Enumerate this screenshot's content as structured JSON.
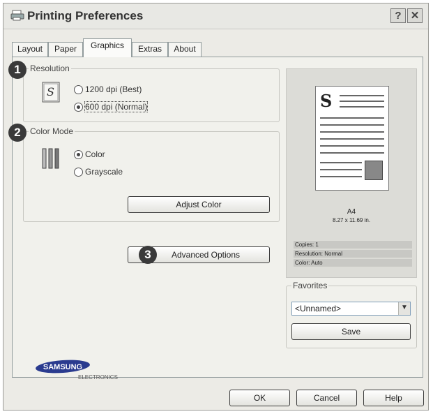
{
  "window": {
    "title": "Printing Preferences",
    "help_button": "?",
    "close_button": "✕"
  },
  "tabs": [
    {
      "label": "Layout"
    },
    {
      "label": "Paper"
    },
    {
      "label": "Graphics"
    },
    {
      "label": "Extras"
    },
    {
      "label": "About"
    }
  ],
  "active_tab": "Graphics",
  "resolution": {
    "badge": "1",
    "label": "Resolution",
    "icon_letter": "S",
    "options": [
      "1200 dpi (Best)",
      "600 dpi (Normal)"
    ],
    "selected": "600 dpi (Normal)"
  },
  "color_mode": {
    "badge": "2",
    "label": "Color Mode",
    "icon_glyph": "jjj",
    "options": [
      "Color",
      "Grayscale"
    ],
    "selected": "Color",
    "adjust_button": "Adjust Color"
  },
  "advanced": {
    "badge": "3",
    "button": "Advanced Options"
  },
  "preview": {
    "page_letter": "S",
    "paper_name": "A4",
    "paper_size": "8.27 x 11.69 in.",
    "info": [
      "Copies: 1",
      "Resolution: Normal",
      "Color: Auto"
    ]
  },
  "favorites": {
    "label": "Favorites",
    "selected": "<Unnamed>",
    "save_button": "Save"
  },
  "brand": {
    "name": "SAMSUNG",
    "sub": "ELECTRONICS"
  },
  "footer": {
    "ok": "OK",
    "cancel": "Cancel",
    "help": "Help"
  }
}
